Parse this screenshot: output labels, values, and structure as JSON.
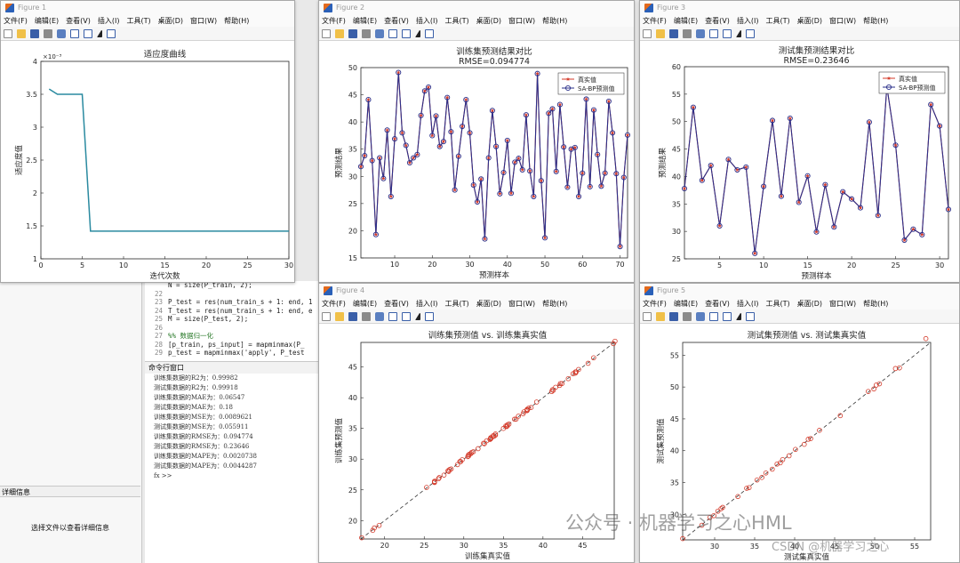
{
  "menu": [
    "文件(F)",
    "编辑(E)",
    "查看(V)",
    "插入(I)",
    "工具(T)",
    "桌面(D)",
    "窗口(W)",
    "帮助(H)"
  ],
  "figures": [
    {
      "title": "Figure 1"
    },
    {
      "title": "Figure 2"
    },
    {
      "title": "Figure 3"
    },
    {
      "title": "Figure 4"
    },
    {
      "title": "Figure 5"
    }
  ],
  "editor": {
    "lines": [
      {
        "n": "",
        "code": "N = size(P_train, 2);"
      },
      {
        "n": "22",
        "code": ""
      },
      {
        "n": "23",
        "code": "P_test = res(num_train_s + 1: end, 1"
      },
      {
        "n": "24",
        "code": "T_test = res(num_train_s + 1: end, e"
      },
      {
        "n": "25",
        "code": "M = size(P_test, 2);"
      },
      {
        "n": "26",
        "code": ""
      },
      {
        "n": "27",
        "code": "%% 数据归一化"
      },
      {
        "n": "28",
        "code": "[p_train, ps_input] = mapminmax(P_"
      },
      {
        "n": "29",
        "code": "p_test = mapminmax('apply', P_test"
      }
    ]
  },
  "command_window": {
    "header": "命令行窗口",
    "lines": [
      "训练集数据的R2为：0.99982",
      "测试集数据的R2为：0.99918",
      "训练集数据的MAE为：0.06547",
      "测试集数据的MAE为：0.18",
      "训练集数据的MSE为：0.0089621",
      "测试集数据的MSE为：0.055911",
      "训练集数据的RMSE为：0.094774",
      "测试集数据的RMSE为：0.23646",
      "训练集数据的MAPE为：0.0020738",
      "测试集数据的MAPE为：0.0044287"
    ],
    "prompt": "fx >>"
  },
  "left_panel": {
    "header": "详细信息",
    "text": "选择文件以查看详细信息"
  },
  "watermark": {
    "main": "公众号 · 机器学习之心HML",
    "sub": "CSDN @机器学习之心"
  },
  "chart_data": [
    {
      "type": "line",
      "title": "适应度曲线",
      "xlabel": "迭代次数",
      "ylabel": "适应度值",
      "y_exponent": "×10⁻³",
      "xlim": [
        0,
        30
      ],
      "ylim": [
        1,
        4
      ],
      "xticks": [
        "0",
        "5",
        "10",
        "15",
        "20",
        "25",
        "30"
      ],
      "yticks": [
        "1",
        "1.5",
        "2",
        "2.5",
        "3",
        "3.5",
        "4"
      ],
      "color": "#2a8aa0",
      "x": [
        1,
        2,
        3,
        4,
        5,
        6,
        7,
        8,
        9,
        10,
        11,
        12,
        13,
        14,
        15,
        16,
        17,
        18,
        19,
        20,
        21,
        22,
        23,
        24,
        25,
        26,
        27,
        28,
        29,
        30
      ],
      "y": [
        3.58,
        3.5,
        3.5,
        3.5,
        3.5,
        1.42,
        1.42,
        1.42,
        1.42,
        1.42,
        1.42,
        1.42,
        1.42,
        1.42,
        1.42,
        1.42,
        1.42,
        1.42,
        1.42,
        1.42,
        1.42,
        1.42,
        1.42,
        1.42,
        1.42,
        1.42,
        1.42,
        1.42,
        1.42,
        1.42
      ]
    },
    {
      "type": "line",
      "title": "训练集预测结果对比",
      "subtitle": "RMSE=0.094774",
      "xlabel": "预测样本",
      "ylabel": "预测结果",
      "xlim": [
        1,
        72
      ],
      "ylim": [
        15,
        50
      ],
      "xticks": [
        "10",
        "20",
        "30",
        "40",
        "50",
        "60",
        "70"
      ],
      "yticks": [
        "15",
        "20",
        "25",
        "30",
        "35",
        "40",
        "45",
        "50"
      ],
      "legend_position": "top-right",
      "series": [
        {
          "name": "真实值",
          "color": "#d43a2a",
          "marker": "star"
        },
        {
          "name": "SA-BP预测值",
          "color": "#2a2f8a",
          "marker": "circle"
        }
      ],
      "x": [
        1,
        2,
        3,
        4,
        5,
        6,
        7,
        8,
        9,
        10,
        11,
        12,
        13,
        14,
        15,
        16,
        17,
        18,
        19,
        20,
        21,
        22,
        23,
        24,
        25,
        26,
        27,
        28,
        29,
        30,
        31,
        32,
        33,
        34,
        35,
        36,
        37,
        38,
        39,
        40,
        41,
        42,
        43,
        44,
        45,
        46,
        47,
        48,
        49,
        50,
        51,
        52,
        53,
        54,
        55,
        56,
        57,
        58,
        59,
        60,
        61,
        62,
        63,
        64,
        65,
        66,
        67,
        68,
        69,
        70,
        71,
        72
      ],
      "y": [
        31.8,
        33.8,
        44.1,
        32.9,
        19.3,
        33.4,
        29.6,
        38.5,
        26.3,
        36.9,
        49.1,
        38.0,
        35.7,
        32.5,
        33.4,
        34.0,
        41.2,
        45.7,
        46.4,
        37.5,
        41.1,
        35.5,
        36.4,
        44.5,
        38.2,
        27.5,
        33.7,
        39.2,
        44.1,
        38.0,
        28.4,
        25.3,
        29.5,
        18.5,
        33.4,
        42.1,
        35.5,
        26.8,
        30.7,
        36.6,
        26.9,
        32.6,
        33.3,
        31.2,
        41.3,
        31.0,
        26.3,
        48.9,
        29.2,
        18.7,
        41.6,
        42.4,
        30.9,
        43.2,
        35.4,
        28.0,
        35.0,
        35.3,
        26.3,
        30.6,
        44.2,
        28.1,
        42.2,
        34.0,
        28.2,
        30.6,
        43.8,
        38.0,
        30.5,
        17.1,
        29.8,
        37.6
      ]
    },
    {
      "type": "line",
      "title": "测试集预测结果对比",
      "subtitle": "RMSE=0.23646",
      "xlabel": "预测样本",
      "ylabel": "预测结果",
      "xlim": [
        1,
        31
      ],
      "ylim": [
        25,
        60
      ],
      "xticks": [
        "5",
        "10",
        "15",
        "20",
        "25",
        "30"
      ],
      "yticks": [
        "25",
        "30",
        "35",
        "40",
        "45",
        "50",
        "55",
        "60"
      ],
      "legend_position": "top-right",
      "series": [
        {
          "name": "真实值",
          "color": "#d43a2a",
          "marker": "star"
        },
        {
          "name": "SA-BP预测值",
          "color": "#2a2f8a",
          "marker": "circle"
        }
      ],
      "x": [
        1,
        2,
        3,
        4,
        5,
        6,
        7,
        8,
        9,
        10,
        11,
        12,
        13,
        14,
        15,
        16,
        17,
        18,
        19,
        20,
        21,
        22,
        23,
        24,
        25,
        26,
        27,
        28,
        29,
        30,
        31
      ],
      "y": [
        37.8,
        52.6,
        39.3,
        42.0,
        31.0,
        43.1,
        41.2,
        41.7,
        26.0,
        38.2,
        50.2,
        36.4,
        50.6,
        35.3,
        40.1,
        29.9,
        38.5,
        30.8,
        37.2,
        35.9,
        34.3,
        49.9,
        32.9,
        56.4,
        45.7,
        28.4,
        30.4,
        29.4,
        53.1,
        49.2,
        34.0
      ]
    },
    {
      "type": "scatter",
      "title": "训练集预测值 vs. 训练集真实值",
      "xlabel": "训练集真实值",
      "ylabel": "训练集预测值",
      "xlim": [
        17,
        49
      ],
      "ylim": [
        17,
        49
      ],
      "xticks": [
        "20",
        "25",
        "30",
        "35",
        "40",
        "45"
      ],
      "yticks": [
        "20",
        "25",
        "30",
        "35",
        "40",
        "45"
      ],
      "color": "#d43a2a",
      "x": [
        17.1,
        18.5,
        18.7,
        19.3,
        25.3,
        26.3,
        26.3,
        26.3,
        26.8,
        26.9,
        27.5,
        28.0,
        28.1,
        28.2,
        28.4,
        29.2,
        29.5,
        29.6,
        29.8,
        30.5,
        30.6,
        30.6,
        30.7,
        30.9,
        31.0,
        31.2,
        31.8,
        32.5,
        32.6,
        32.9,
        33.3,
        33.4,
        33.4,
        33.4,
        33.7,
        33.8,
        34.0,
        34.0,
        35.0,
        35.3,
        35.4,
        35.5,
        35.5,
        35.7,
        36.4,
        36.6,
        36.9,
        37.5,
        37.6,
        38.0,
        38.0,
        38.0,
        38.2,
        38.5,
        39.2,
        41.1,
        41.2,
        41.3,
        41.6,
        42.1,
        42.2,
        42.4,
        43.2,
        43.8,
        44.1,
        44.1,
        44.2,
        44.5,
        45.7,
        46.4,
        48.9,
        49.1
      ],
      "y": [
        17.2,
        18.4,
        18.8,
        19.2,
        25.4,
        26.2,
        26.4,
        26.3,
        26.8,
        27.0,
        27.4,
        28.1,
        28.0,
        28.3,
        28.4,
        29.1,
        29.6,
        29.6,
        29.9,
        30.4,
        30.7,
        30.5,
        30.8,
        30.9,
        31.1,
        31.2,
        31.7,
        32.6,
        32.5,
        33.0,
        33.2,
        33.5,
        33.3,
        33.4,
        33.8,
        33.7,
        34.1,
        33.9,
        35.0,
        35.4,
        35.3,
        35.6,
        35.4,
        35.7,
        36.5,
        36.5,
        37.0,
        37.4,
        37.7,
        37.9,
        38.1,
        38.0,
        38.3,
        38.4,
        39.3,
        41.0,
        41.3,
        41.2,
        41.7,
        42.0,
        42.3,
        42.3,
        43.1,
        43.9,
        44.0,
        44.2,
        44.2,
        44.6,
        45.6,
        46.5,
        48.8,
        49.2
      ]
    },
    {
      "type": "scatter",
      "title": "测试集预测值 vs. 测试集真实值",
      "xlabel": "测试集真实值",
      "ylabel": "测试集预测值",
      "xlim": [
        26,
        57
      ],
      "ylim": [
        26,
        57
      ],
      "xticks": [
        "30",
        "35",
        "40",
        "45",
        "50",
        "55"
      ],
      "yticks": [
        "30",
        "35",
        "40",
        "45",
        "50",
        "55"
      ],
      "color": "#d43a2a",
      "x": [
        26.0,
        28.4,
        29.4,
        29.9,
        30.4,
        30.8,
        31.0,
        32.9,
        34.0,
        34.3,
        35.3,
        35.9,
        36.4,
        37.2,
        37.8,
        38.2,
        38.5,
        39.3,
        40.1,
        41.2,
        41.7,
        42.0,
        43.1,
        45.7,
        49.2,
        49.9,
        50.2,
        50.6,
        52.6,
        53.1,
        56.4
      ],
      "y": [
        26.2,
        28.3,
        29.5,
        29.8,
        30.5,
        30.9,
        31.1,
        32.8,
        34.1,
        34.2,
        35.4,
        35.8,
        36.5,
        37.1,
        37.9,
        38.1,
        38.6,
        39.2,
        40.2,
        41.0,
        41.8,
        41.9,
        43.2,
        45.5,
        49.3,
        49.7,
        50.3,
        50.5,
        52.9,
        53.0,
        57.6
      ]
    }
  ]
}
